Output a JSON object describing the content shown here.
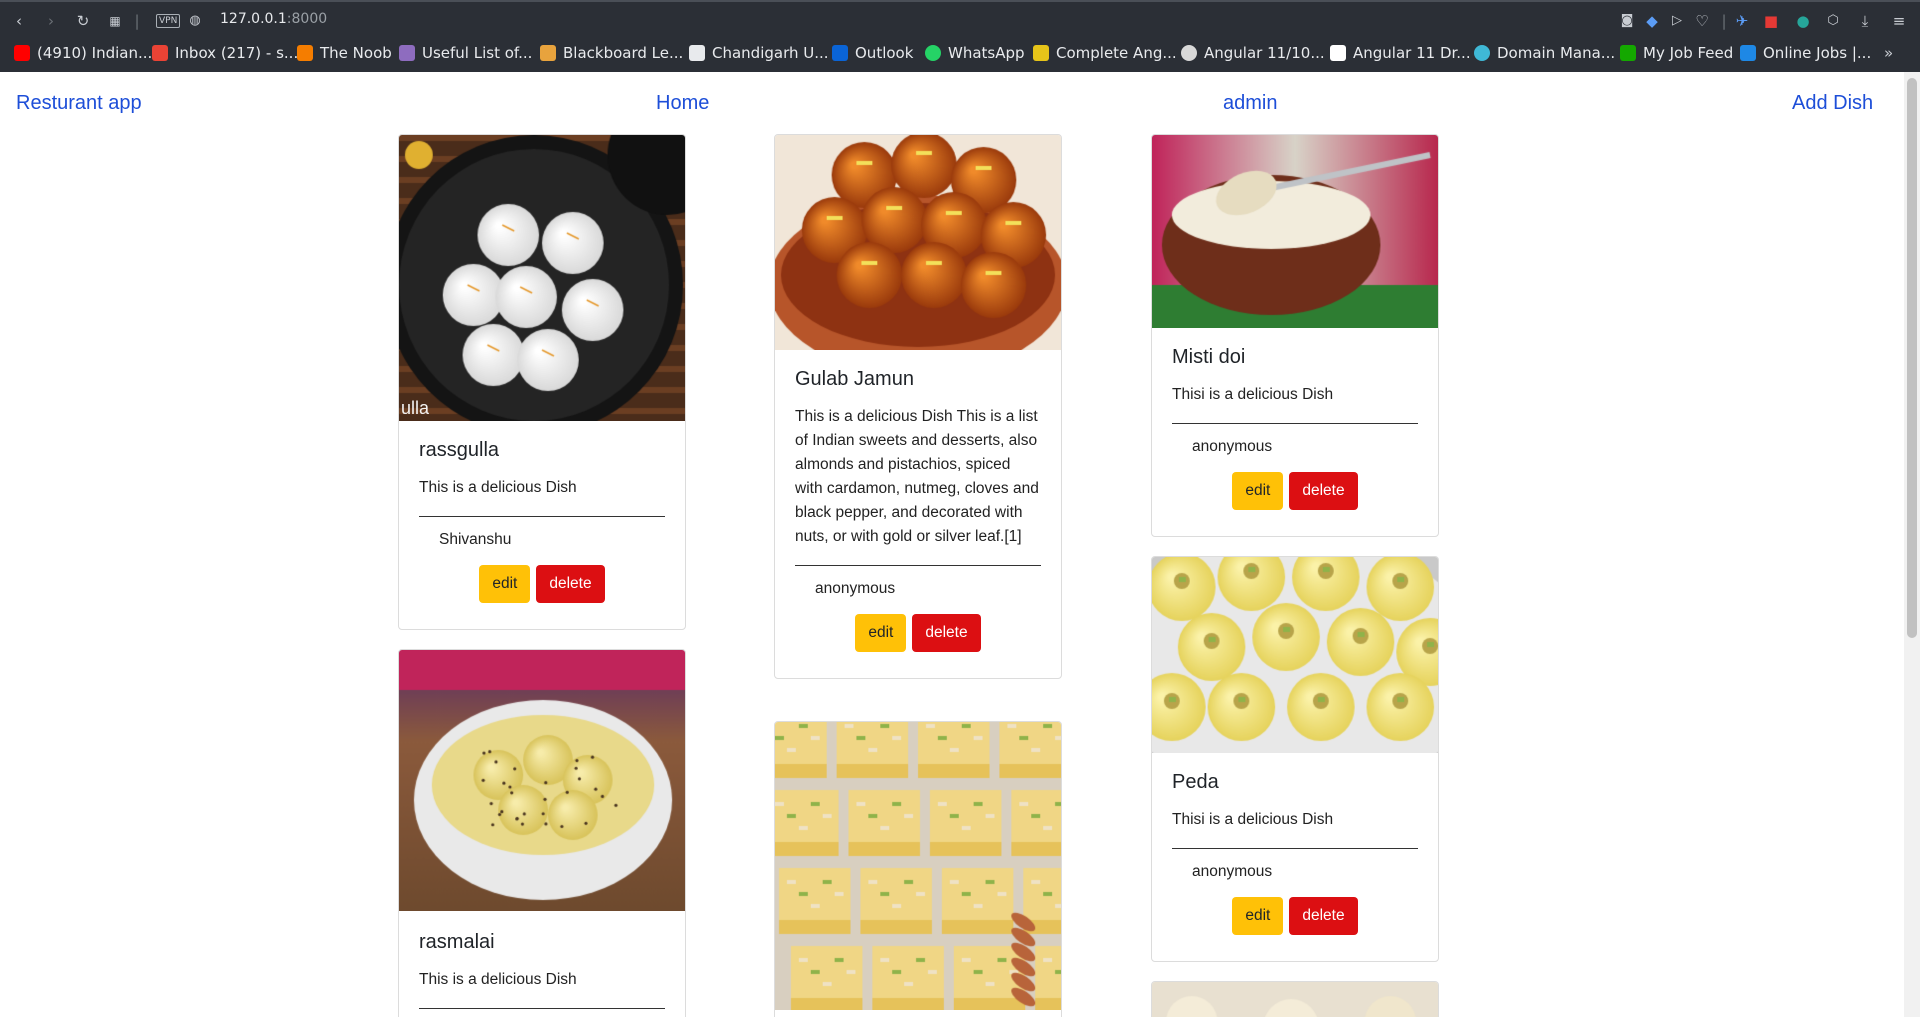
{
  "browser": {
    "url_host": "127.0.0.1",
    "url_port": ":8000",
    "vpn_label": "VPN",
    "bookmarks": [
      {
        "label": "(4910) Indian...",
        "color": "#ff0000"
      },
      {
        "label": "Inbox (217) - s...",
        "color": "#ea4335"
      },
      {
        "label": "The Noob",
        "color": "#f57d00"
      },
      {
        "label": "Useful List of...",
        "color": "#8e6cbf"
      },
      {
        "label": "Blackboard Le...",
        "color": "#e8a33d"
      },
      {
        "label": "Chandigarh U...",
        "color": "#e8eaed"
      },
      {
        "label": "Outlook",
        "color": "#0a64d6"
      },
      {
        "label": "WhatsApp",
        "color": "#25d366"
      },
      {
        "label": "Complete Ang...",
        "color": "#e6c419"
      },
      {
        "label": "Angular 11/10...",
        "color": "#d8d8d8"
      },
      {
        "label": "Angular 11 Dr...",
        "color": "#ffffff"
      },
      {
        "label": "Domain Mana...",
        "color": "#3fb8d6"
      },
      {
        "label": "My Job Feed",
        "color": "#14a800"
      },
      {
        "label": "Online Jobs |...",
        "color": "#1e88e5"
      }
    ]
  },
  "nav": {
    "brand": "Resturant app",
    "home": "Home",
    "admin": "admin",
    "add_dish": "Add Dish"
  },
  "dishes": [
    {
      "name": "rassgulla",
      "description": "This is a delicious Dish",
      "author": "Shivanshu",
      "edit_label": "edit",
      "delete_label": "delete",
      "image_caption": "ulla"
    },
    {
      "name": "rasmalai",
      "description": "This is a delicious Dish",
      "author": "",
      "edit_label": "edit",
      "delete_label": "delete"
    },
    {
      "name": "Gulab Jamun",
      "description": "This is a delicious Dish This is a list of Indian sweets and desserts, also almonds and pistachios, spiced with cardamon, nutmeg, cloves and black pepper, and decorated with nuts, or with gold or silver leaf.[1]",
      "author": "anonymous",
      "edit_label": "edit",
      "delete_label": "delete"
    },
    {
      "name": "",
      "description": "",
      "author": "",
      "edit_label": "edit",
      "delete_label": "delete"
    },
    {
      "name": "Misti doi",
      "description": "Thisi is a delicious Dish",
      "author": "anonymous",
      "edit_label": "edit",
      "delete_label": "delete"
    },
    {
      "name": "Peda",
      "description": "Thisi is a delicious Dish",
      "author": "anonymous",
      "edit_label": "edit",
      "delete_label": "delete"
    }
  ],
  "colors": {
    "nav_link": "#1d4ed8",
    "edit_button": "#ffc107",
    "delete_button": "#dc0f12"
  }
}
